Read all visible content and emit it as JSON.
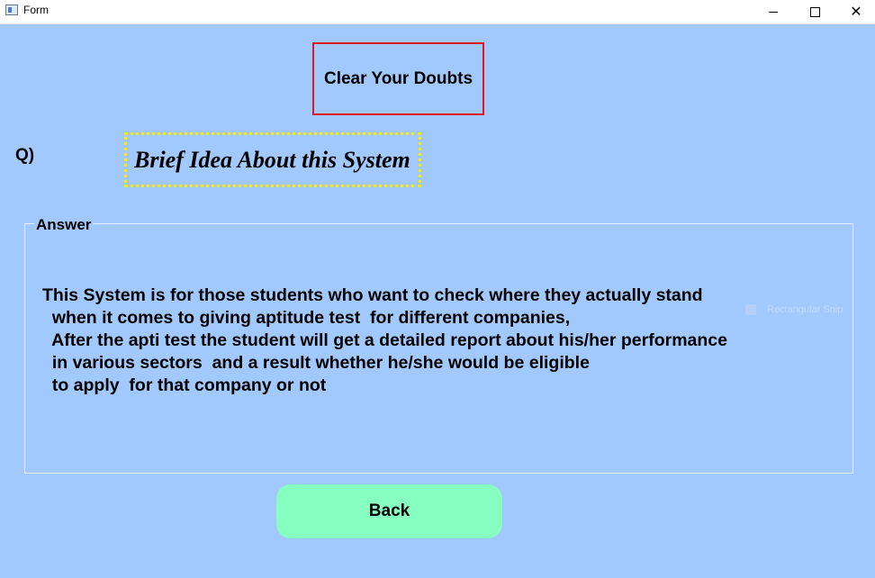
{
  "window": {
    "title": "Form",
    "minimize_glyph": "minimize-icon",
    "maximize_glyph": "maximize-icon",
    "close_glyph": "✕"
  },
  "header": {
    "title": "Clear Your Doubts"
  },
  "question": {
    "label": "Q)",
    "text": "Brief Idea About this System"
  },
  "answer": {
    "group_title": "Answer",
    "text": "This System is for those students who want to check where they actually stand\n  when it comes to giving aptitude test  for different companies,\n  After the apti test the student will get a detailed report about his/her performance\n  in various sectors  and a result whether he/she would be eligible\n  to apply  for that company or not"
  },
  "overlay": {
    "snip_label": "Rectangular Snip"
  },
  "actions": {
    "back_label": "Back"
  },
  "colors": {
    "background": "#a2c9fd",
    "heading_border": "#e0161f",
    "question_border": "#ffeb00",
    "back_button": "#86ffc0"
  }
}
